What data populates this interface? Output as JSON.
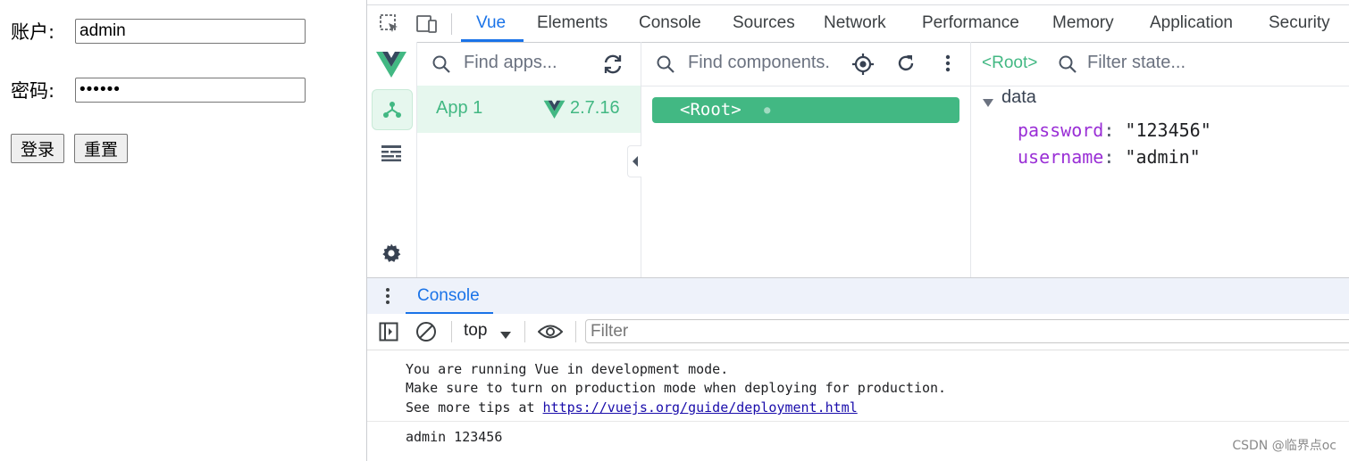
{
  "page": {
    "username_label": "账户:",
    "username_value": "admin",
    "password_label": "密码:",
    "password_value": "••••••",
    "login_button": "登录",
    "reset_button": "重置"
  },
  "devtools": {
    "tabs": [
      "Vue",
      "Elements",
      "Console",
      "Sources",
      "Network",
      "Performance",
      "Memory",
      "Application",
      "Security"
    ],
    "active_tab": "Vue"
  },
  "vue": {
    "apps_search_placeholder": "Find apps...",
    "app_name": "App 1",
    "vue_version": "2.7.16",
    "components_search_placeholder": "Find components...",
    "root_component": "<Root>",
    "state_selected": "<Root>",
    "state_filter_placeholder": "Filter state...",
    "state_section": "data",
    "state": [
      {
        "key": "password",
        "value": "\"123456\""
      },
      {
        "key": "username",
        "value": "\"admin\""
      }
    ]
  },
  "drawer": {
    "tab": "Console"
  },
  "console": {
    "context": "top",
    "filter_placeholder": "Filter",
    "lines": [
      "You are running Vue in development mode.",
      "Make sure to turn on production mode when deploying for production.",
      "See more tips at "
    ],
    "link": "https://vuejs.org/guide/deployment.html",
    "log_output": "admin 123456"
  },
  "watermark": "CSDN @临界点oc",
  "colors": {
    "vue_green": "#42b883",
    "accent_blue": "#1a73e8",
    "state_key": "#9a2fd6"
  }
}
